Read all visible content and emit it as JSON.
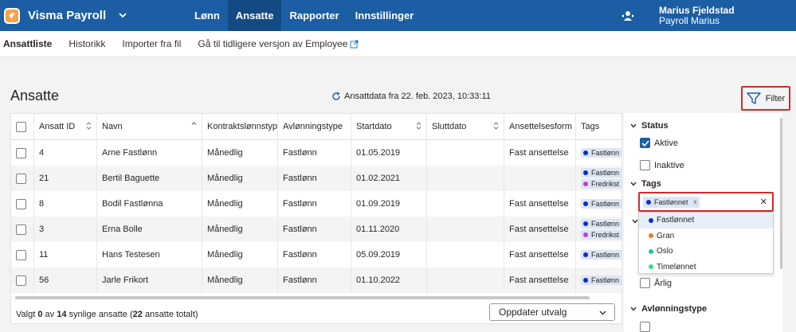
{
  "app": {
    "name": "Visma Payroll",
    "logo_color": "#f6a34a",
    "brand_color": "#1b5ea4"
  },
  "nav": [
    {
      "label": "Lønn",
      "active": false
    },
    {
      "label": "Ansatte",
      "active": true
    },
    {
      "label": "Rapporter",
      "active": false
    },
    {
      "label": "Innstillinger",
      "active": false
    }
  ],
  "user": {
    "name": "Marius Fjeldstad",
    "company": "Payroll Marius"
  },
  "subnav": {
    "items": [
      "Ansattliste",
      "Historikk",
      "Importer fra fil"
    ],
    "external": "Gå til tidligere versjon av Employee"
  },
  "page": {
    "title": "Ansatte",
    "refresh_text": "Ansattdata fra 22. feb. 2023, 10:33:11",
    "filter_label": "Filter"
  },
  "table": {
    "headers": [
      "Ansatt ID",
      "Navn",
      "Kontraktslønnstype",
      "Avlønningstype",
      "Startdato",
      "Sluttdato",
      "Ansettelsesform",
      "Tags"
    ],
    "rows": [
      {
        "id": "4",
        "name": "Arne Fastlønn",
        "contract": "Månedlig",
        "pay": "Fastlønn",
        "start": "01.05.2019",
        "end": "",
        "form": "Fast ansettelse",
        "tags": [
          "Fastlønn"
        ]
      },
      {
        "id": "21",
        "name": "Bertil Baguette",
        "contract": "Månedlig",
        "pay": "Fastlønn",
        "start": "01.02.2021",
        "end": "",
        "form": "",
        "tags": [
          "Fastlønn",
          "Fredrikst"
        ]
      },
      {
        "id": "8",
        "name": "Bodil Fastlønna",
        "contract": "Månedlig",
        "pay": "Fastlønn",
        "start": "01.09.2019",
        "end": "",
        "form": "Fast ansettelse",
        "tags": [
          "Fastlønn"
        ]
      },
      {
        "id": "3",
        "name": "Erna Bolle",
        "contract": "Månedlig",
        "pay": "Fastlønn",
        "start": "01.11.2020",
        "end": "",
        "form": "Fast ansettelse",
        "tags": [
          "Fastlønn",
          "Fredrikst"
        ]
      },
      {
        "id": "11",
        "name": "Hans Testesen",
        "contract": "Månedlig",
        "pay": "Fastlønn",
        "start": "05.09.2019",
        "end": "",
        "form": "Fast ansettelse",
        "tags": [
          "Fastlønn"
        ]
      },
      {
        "id": "56",
        "name": "Jarle Frikort",
        "contract": "Månedlig",
        "pay": "Fastlønn",
        "start": "01.10.2022",
        "end": "",
        "form": "Fast ansettelse",
        "tags": [
          "Fastlønn"
        ]
      }
    ],
    "tag_colors": {
      "Fastlønn": "#0b2bd6",
      "Fredrikst": "#c43ad6"
    },
    "footer": {
      "prefix": "Valgt",
      "selected": "0",
      "mid": "av",
      "visible": "14",
      "suffix": "synlige ansatte (",
      "total": "22",
      "end": "ansatte totalt)"
    },
    "update_button": "Oppdater utvalg"
  },
  "filter": {
    "status_title": "Status",
    "status_options": [
      {
        "label": "Aktive",
        "checked": true
      },
      {
        "label": "Inaktive",
        "checked": false
      }
    ],
    "tags_title": "Tags",
    "selected_chip": "Fastlønnet",
    "chip_remove": "x",
    "clear": "✕",
    "dropdown": [
      {
        "label": "Fastlønnet",
        "color": "#0b2bd6"
      },
      {
        "label": "Gran",
        "color": "#f07a1f"
      },
      {
        "label": "Oslo",
        "color": "#1fc98a"
      },
      {
        "label": "Timelønnet",
        "color": "#2fe07a"
      }
    ],
    "arlig": "Årlig",
    "avl_title": "Avlønningstype"
  }
}
